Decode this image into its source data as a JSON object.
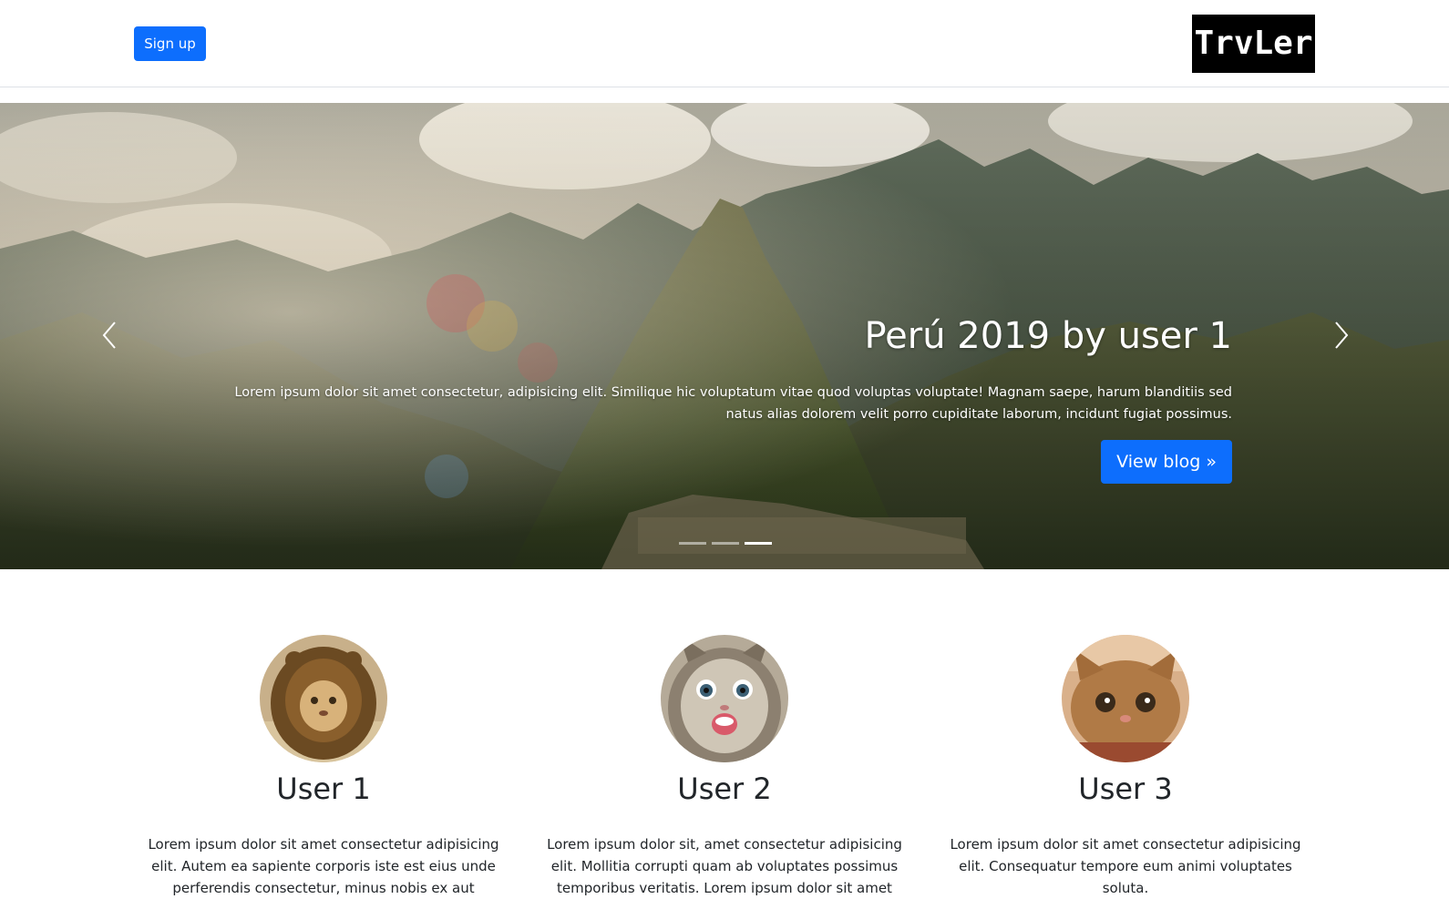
{
  "header": {
    "signup_label": "Sign up",
    "logo_text": "TrvLer"
  },
  "carousel": {
    "title": "Perú 2019 by user 1",
    "text": "Lorem ipsum dolor sit amet consectetur, adipisicing elit. Similique hic voluptatum vitae quod voluptas voluptate! Magnam saepe, harum blanditiis sed natus alias dolorem velit porro cupiditate laborum, incidunt fugiat possimus.",
    "button_label": "View blog »",
    "slide_count": 3,
    "active_index": 2,
    "prev_icon": "chevron-left-icon",
    "next_icon": "chevron-right-icon"
  },
  "users": [
    {
      "name": "User 1",
      "description": "Lorem ipsum dolor sit amet consectetur adipisicing elit. Autem ea sapiente corporis iste est eius unde perferendis consectetur, minus nobis ex aut"
    },
    {
      "name": "User 2",
      "description": "Lorem ipsum dolor sit, amet consectetur adipisicing elit. Mollitia corrupti quam ab voluptates possimus temporibus veritatis. Lorem ipsum dolor sit amet"
    },
    {
      "name": "User 3",
      "description": "Lorem ipsum dolor sit amet consectetur adipisicing elit. Consequatur tempore eum animi voluptates soluta."
    }
  ],
  "colors": {
    "primary": "#0d6efd",
    "logo_bg": "#000000"
  }
}
